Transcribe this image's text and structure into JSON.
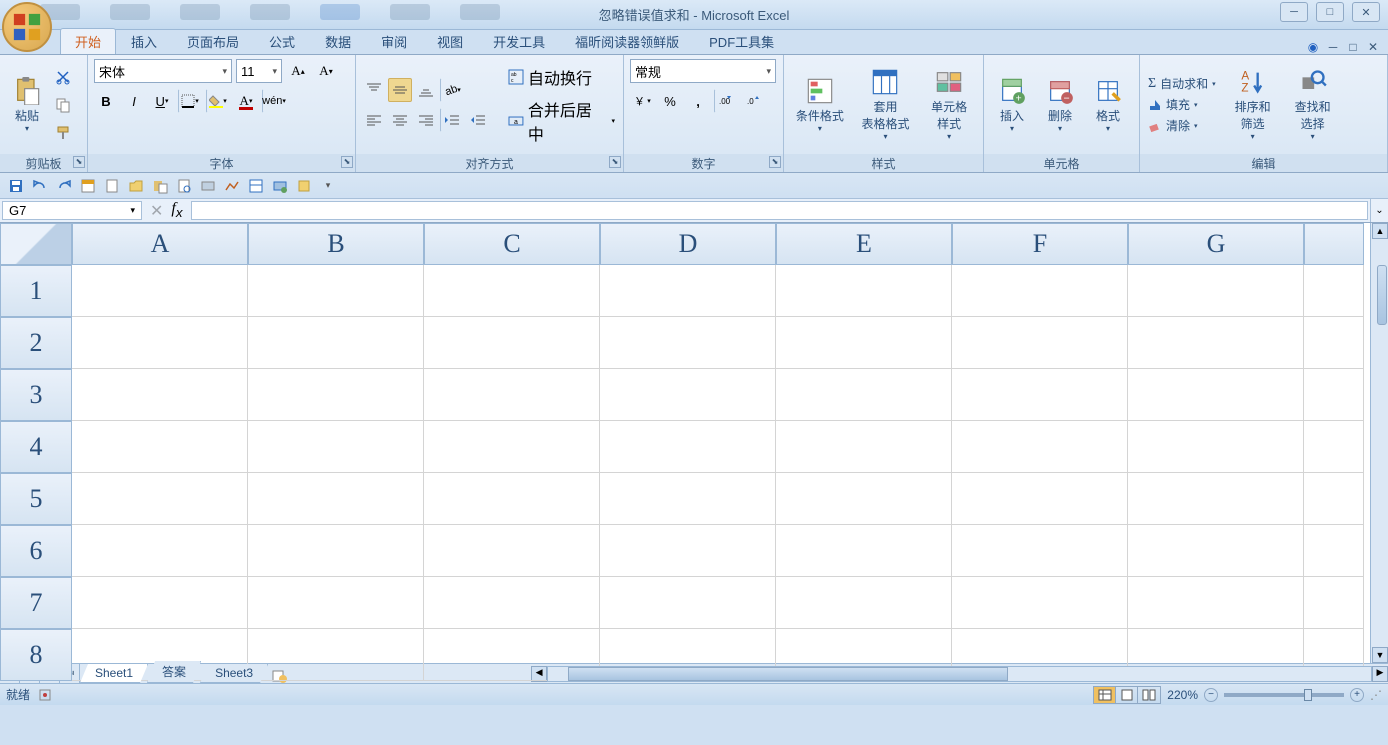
{
  "title": "忽略错误值求和 - Microsoft Excel",
  "tabs": [
    "开始",
    "插入",
    "页面布局",
    "公式",
    "数据",
    "审阅",
    "视图",
    "开发工具",
    "福昕阅读器领鲜版",
    "PDF工具集"
  ],
  "active_tab": 0,
  "ribbon": {
    "clipboard": {
      "label": "剪贴板",
      "paste": "粘贴"
    },
    "font": {
      "label": "字体",
      "name": "宋体",
      "size": "11"
    },
    "align": {
      "label": "对齐方式",
      "wrap": "自动换行",
      "merge": "合并后居中"
    },
    "number": {
      "label": "数字",
      "format": "常规"
    },
    "styles": {
      "label": "样式",
      "cond": "条件格式",
      "table": "套用\n表格格式",
      "cell": "单元格\n样式"
    },
    "cells": {
      "label": "单元格",
      "insert": "插入",
      "delete": "删除",
      "format": "格式"
    },
    "edit": {
      "label": "编辑",
      "sum": "自动求和",
      "fill": "填充",
      "clear": "清除",
      "sort": "排序和\n筛选",
      "find": "查找和\n选择"
    }
  },
  "namebox": "G7",
  "columns": [
    "A",
    "B",
    "C",
    "D",
    "E",
    "F",
    "G"
  ],
  "rows": [
    "1",
    "2",
    "3",
    "4",
    "5",
    "6",
    "7",
    "8"
  ],
  "sheets": [
    "Sheet1",
    "答案",
    "Sheet3"
  ],
  "active_sheet": 0,
  "status": "就绪",
  "zoom": "220%"
}
